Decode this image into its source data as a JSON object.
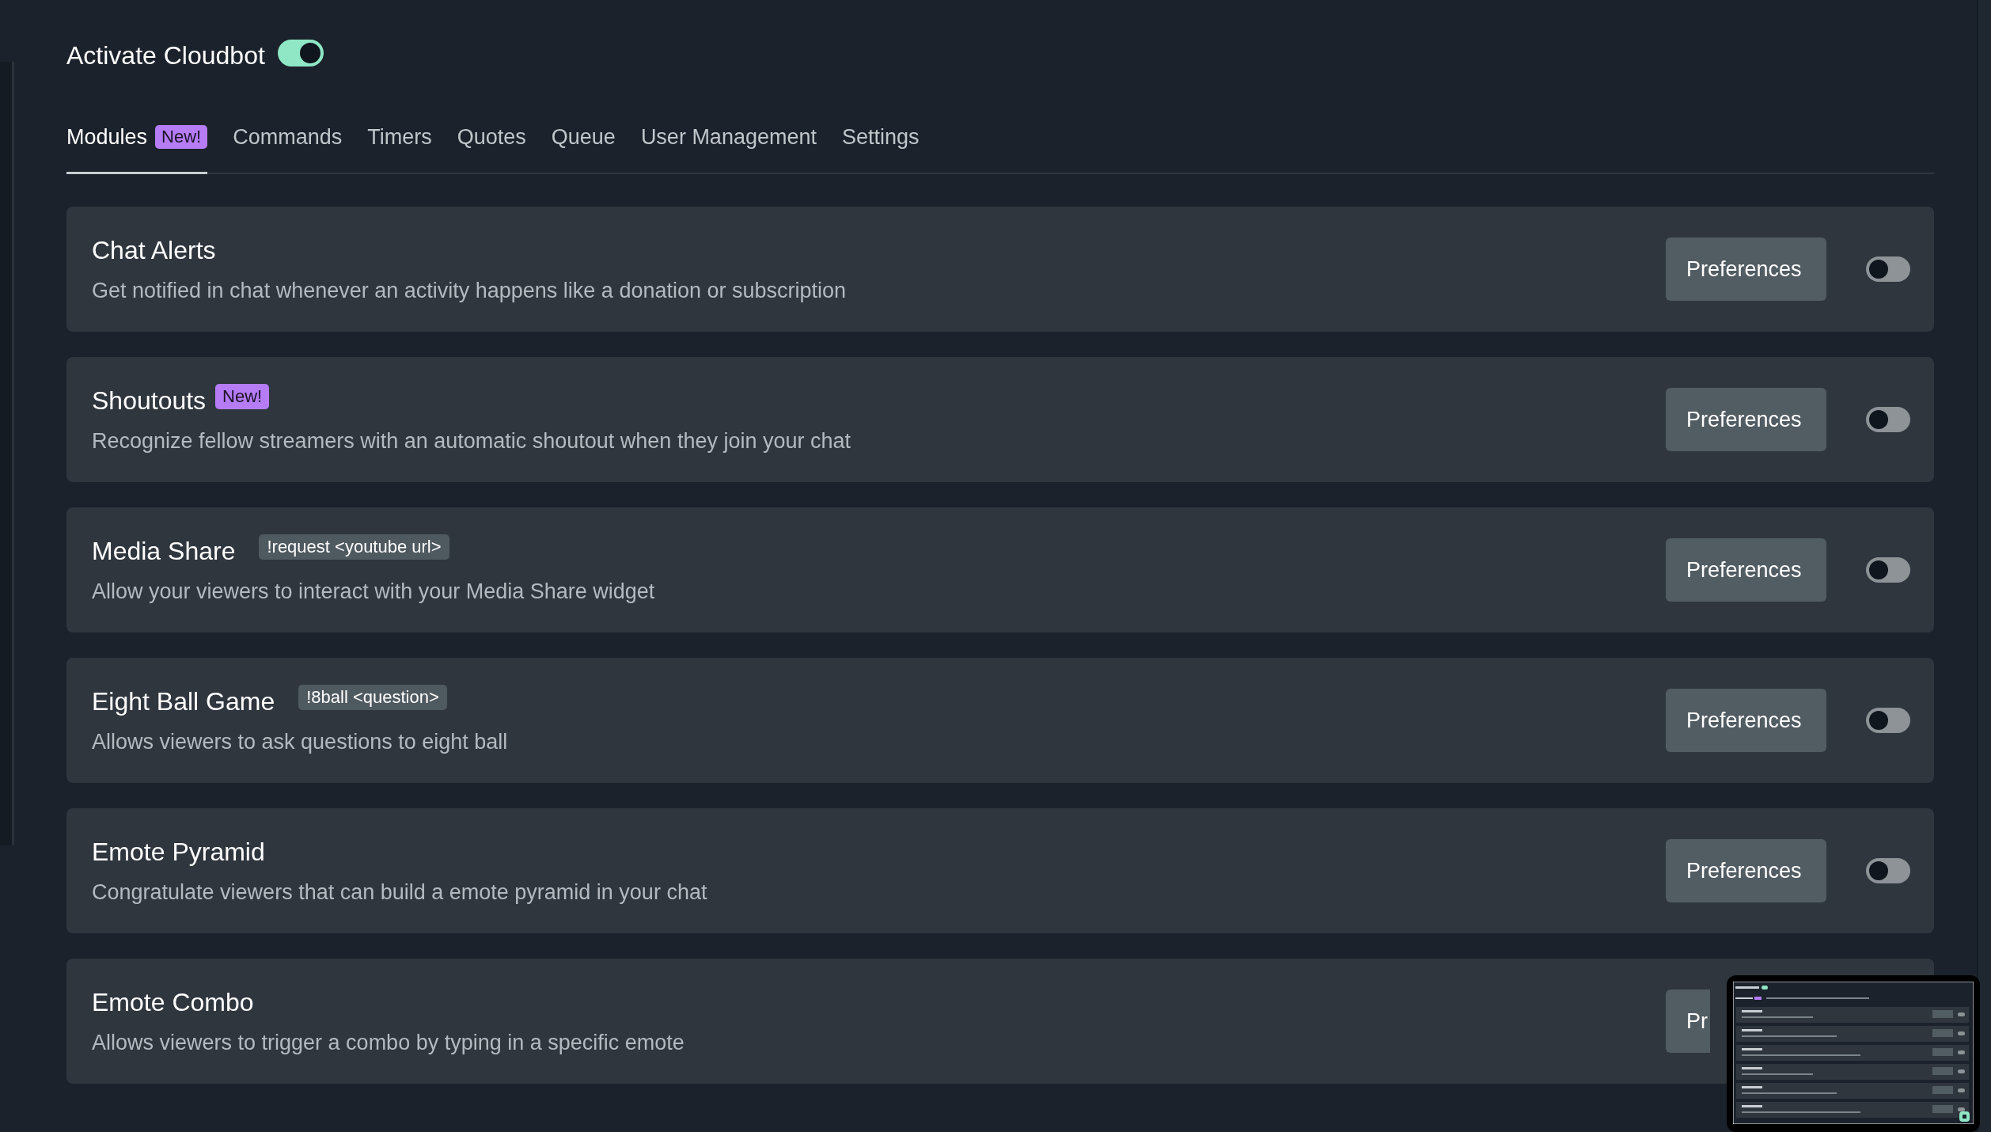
{
  "header": {
    "title": "Activate Cloudbot",
    "on": true
  },
  "tabs": [
    {
      "label": "Modules",
      "badge": "New!",
      "selected": true
    },
    {
      "label": "Commands",
      "selected": false
    },
    {
      "label": "Timers",
      "selected": false
    },
    {
      "label": "Quotes",
      "selected": false
    },
    {
      "label": "Queue",
      "selected": false
    },
    {
      "label": "User Management",
      "selected": false
    },
    {
      "label": "Settings",
      "selected": false
    }
  ],
  "modules": [
    {
      "title": "Chat Alerts",
      "description": "Get notified in chat whenever an activity happens like a donation or subscription",
      "button": "Preferences",
      "on": false
    },
    {
      "title": "Shoutouts",
      "badge": "New!",
      "description": "Recognize fellow streamers with an automatic shoutout when they join your chat",
      "button": "Preferences",
      "on": false
    },
    {
      "title": "Media Share",
      "command": "!request <youtube url>",
      "description": "Allow your viewers to interact with your Media Share widget",
      "button": "Preferences",
      "on": false
    },
    {
      "title": "Eight Ball Game",
      "command": "!8ball <question>",
      "description": "Allows viewers to ask questions to eight ball",
      "button": "Preferences",
      "on": false
    },
    {
      "title": "Emote Pyramid",
      "description": "Congratulate viewers that can build a emote pyramid in your chat",
      "button": "Preferences",
      "on": false
    },
    {
      "title": "Emote Combo",
      "description": "Allows viewers to trigger a combo by typing in a specific emote",
      "button": "Pr",
      "cut": true
    }
  ]
}
